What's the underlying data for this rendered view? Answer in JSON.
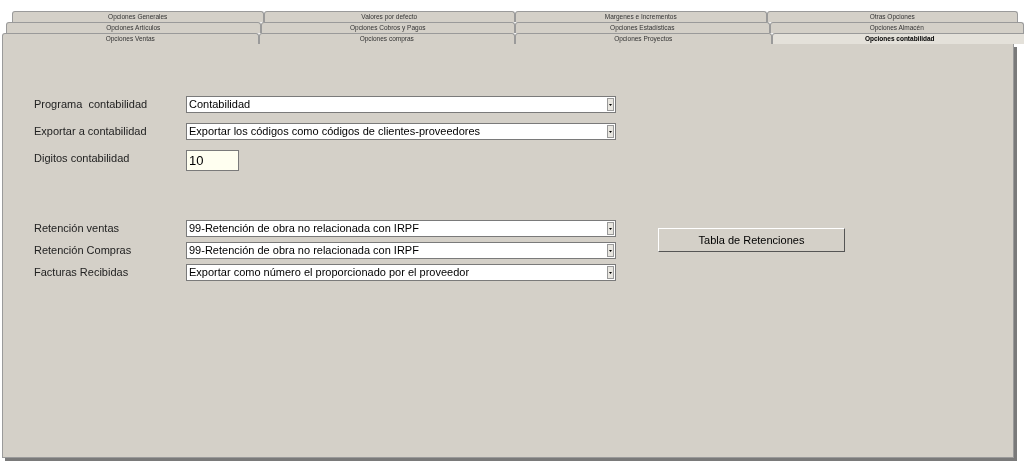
{
  "tab_rows": [
    [
      {
        "label": "Opciones Generales",
        "selected": false
      },
      {
        "label": "Valores por defecto",
        "selected": false
      },
      {
        "label": "Margenes e Incrementos",
        "selected": false
      },
      {
        "label": "Otras Opciones",
        "selected": false
      }
    ],
    [
      {
        "label": "Opciones Artículos",
        "selected": false
      },
      {
        "label": "Opciones Cobros y Pagos",
        "selected": false
      },
      {
        "label": "Opciones Estadísticas",
        "selected": false
      },
      {
        "label": "Opciones Almacén",
        "selected": false
      }
    ],
    [
      {
        "label": "Opciones Ventas",
        "selected": false
      },
      {
        "label": "Opciones compras",
        "selected": false
      },
      {
        "label": "Opciones Proyectos",
        "selected": false
      },
      {
        "label": "Opciones contabilidad",
        "selected": true
      }
    ]
  ],
  "sections": [
    {
      "fields": [
        {
          "kind": "select",
          "label": "Programa  contabilidad",
          "value": "Contabilidad"
        },
        {
          "kind": "select",
          "label": "Exportar a contabilidad",
          "value": "Exportar los códigos como códigos de clientes-proveedores"
        },
        {
          "kind": "text",
          "label": "Digitos contabilidad",
          "value": "10"
        }
      ]
    },
    {
      "fields": [
        {
          "kind": "select",
          "label": "Retención ventas",
          "value": "99-Retención de obra no relacionada con IRPF"
        },
        {
          "kind": "select",
          "label": "Retención Compras",
          "value": "99-Retención de obra no relacionada con IRPF"
        },
        {
          "kind": "select",
          "label": "Facturas Recibidas",
          "value": "Exportar como número el proporcionado por el proveedor"
        }
      ],
      "button": "Tabla de Retenciones"
    }
  ]
}
